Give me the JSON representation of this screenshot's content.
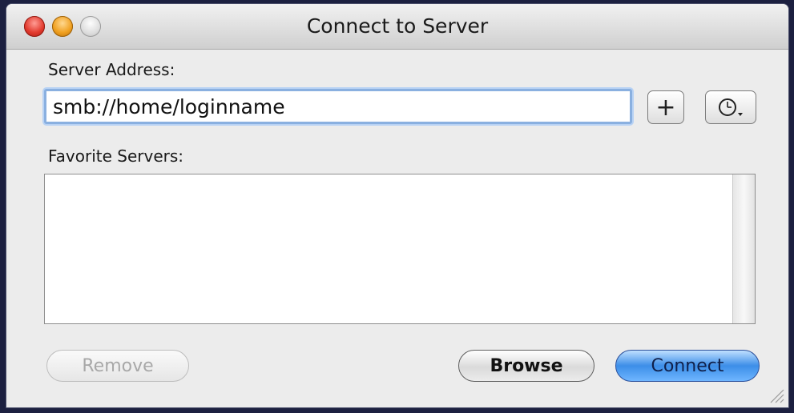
{
  "window": {
    "title": "Connect to Server",
    "traffic_lights": [
      "close",
      "minimize",
      "zoom"
    ]
  },
  "server_address": {
    "label": "Server Address:",
    "value": "smb://home/loginname"
  },
  "buttons": {
    "add_label": "+",
    "history_icon": "clock-icon",
    "remove_label": "Remove",
    "browse_label": "Browse",
    "connect_label": "Connect"
  },
  "favorites": {
    "label": "Favorite Servers:",
    "items": []
  },
  "colors": {
    "focus_ring": "#8ab0e0",
    "default_button": "#3c8ee8"
  }
}
